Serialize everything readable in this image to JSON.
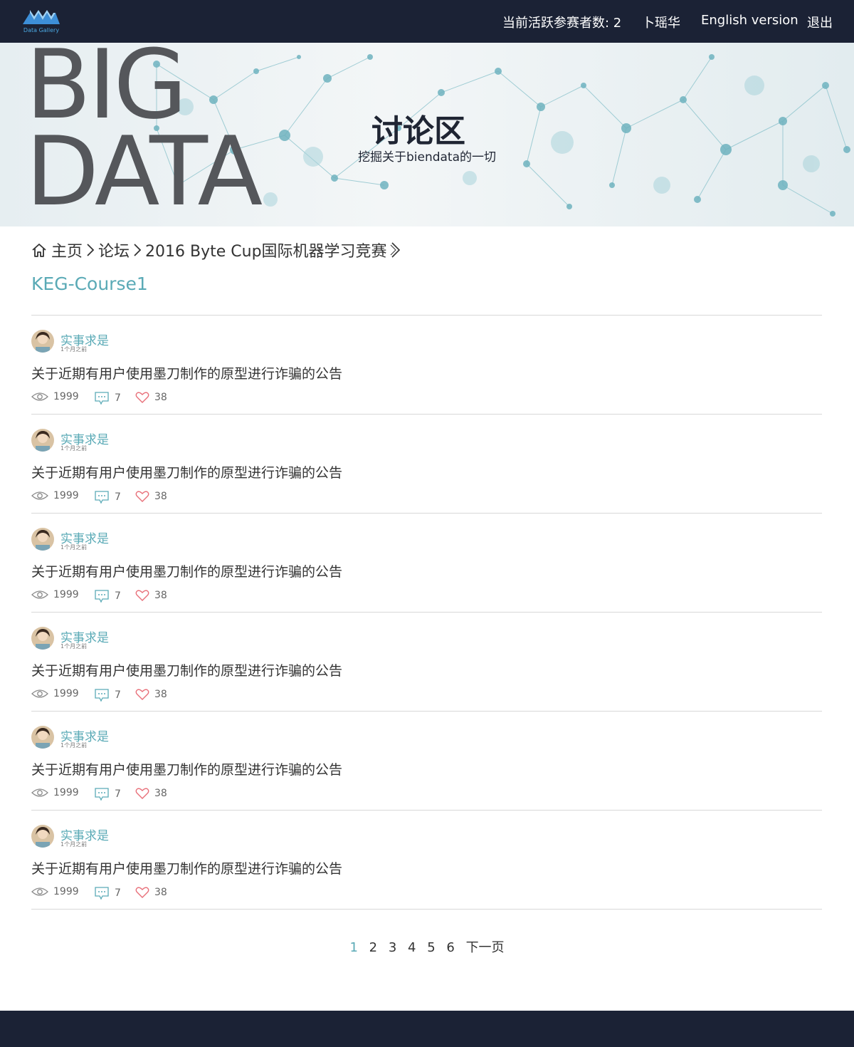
{
  "brand": {
    "logo_text": "Data Gallery"
  },
  "nav": {
    "active_users": "当前活跃参赛者数: 2",
    "username": "卜瑶华",
    "language": "English version",
    "logout": "退出"
  },
  "banner": {
    "big_line1": "BIG",
    "big_line2": "DATA",
    "title": "讨论区",
    "subtitle": "挖掘关于biendata的一切"
  },
  "breadcrumb": {
    "home": "主页",
    "forum": "论坛",
    "competition": "2016 Byte Cup国际机器学习竞赛"
  },
  "course_title": "KEG-Course1",
  "posts": [
    {
      "author": "实事求是",
      "time": "1个月之前",
      "title": "关于近期有用户使用墨刀制作的原型进行诈骗的公告",
      "views": "1999",
      "comments": "7",
      "likes": "38"
    },
    {
      "author": "实事求是",
      "time": "1个月之前",
      "title": "关于近期有用户使用墨刀制作的原型进行诈骗的公告",
      "views": "1999",
      "comments": "7",
      "likes": "38"
    },
    {
      "author": "实事求是",
      "time": "1个月之前",
      "title": "关于近期有用户使用墨刀制作的原型进行诈骗的公告",
      "views": "1999",
      "comments": "7",
      "likes": "38"
    },
    {
      "author": "实事求是",
      "time": "1个月之前",
      "title": "关于近期有用户使用墨刀制作的原型进行诈骗的公告",
      "views": "1999",
      "comments": "7",
      "likes": "38"
    },
    {
      "author": "实事求是",
      "time": "1个月之前",
      "title": "关于近期有用户使用墨刀制作的原型进行诈骗的公告",
      "views": "1999",
      "comments": "7",
      "likes": "38"
    },
    {
      "author": "实事求是",
      "time": "1个月之前",
      "title": "关于近期有用户使用墨刀制作的原型进行诈骗的公告",
      "views": "1999",
      "comments": "7",
      "likes": "38"
    }
  ],
  "pagination": {
    "pages": [
      "1",
      "2",
      "3",
      "4",
      "5",
      "6"
    ],
    "current": "1",
    "next": "下一页"
  },
  "colors": {
    "nav_bg": "#1b2235",
    "accent": "#5aaab6",
    "like_icon": "#e8707a"
  }
}
